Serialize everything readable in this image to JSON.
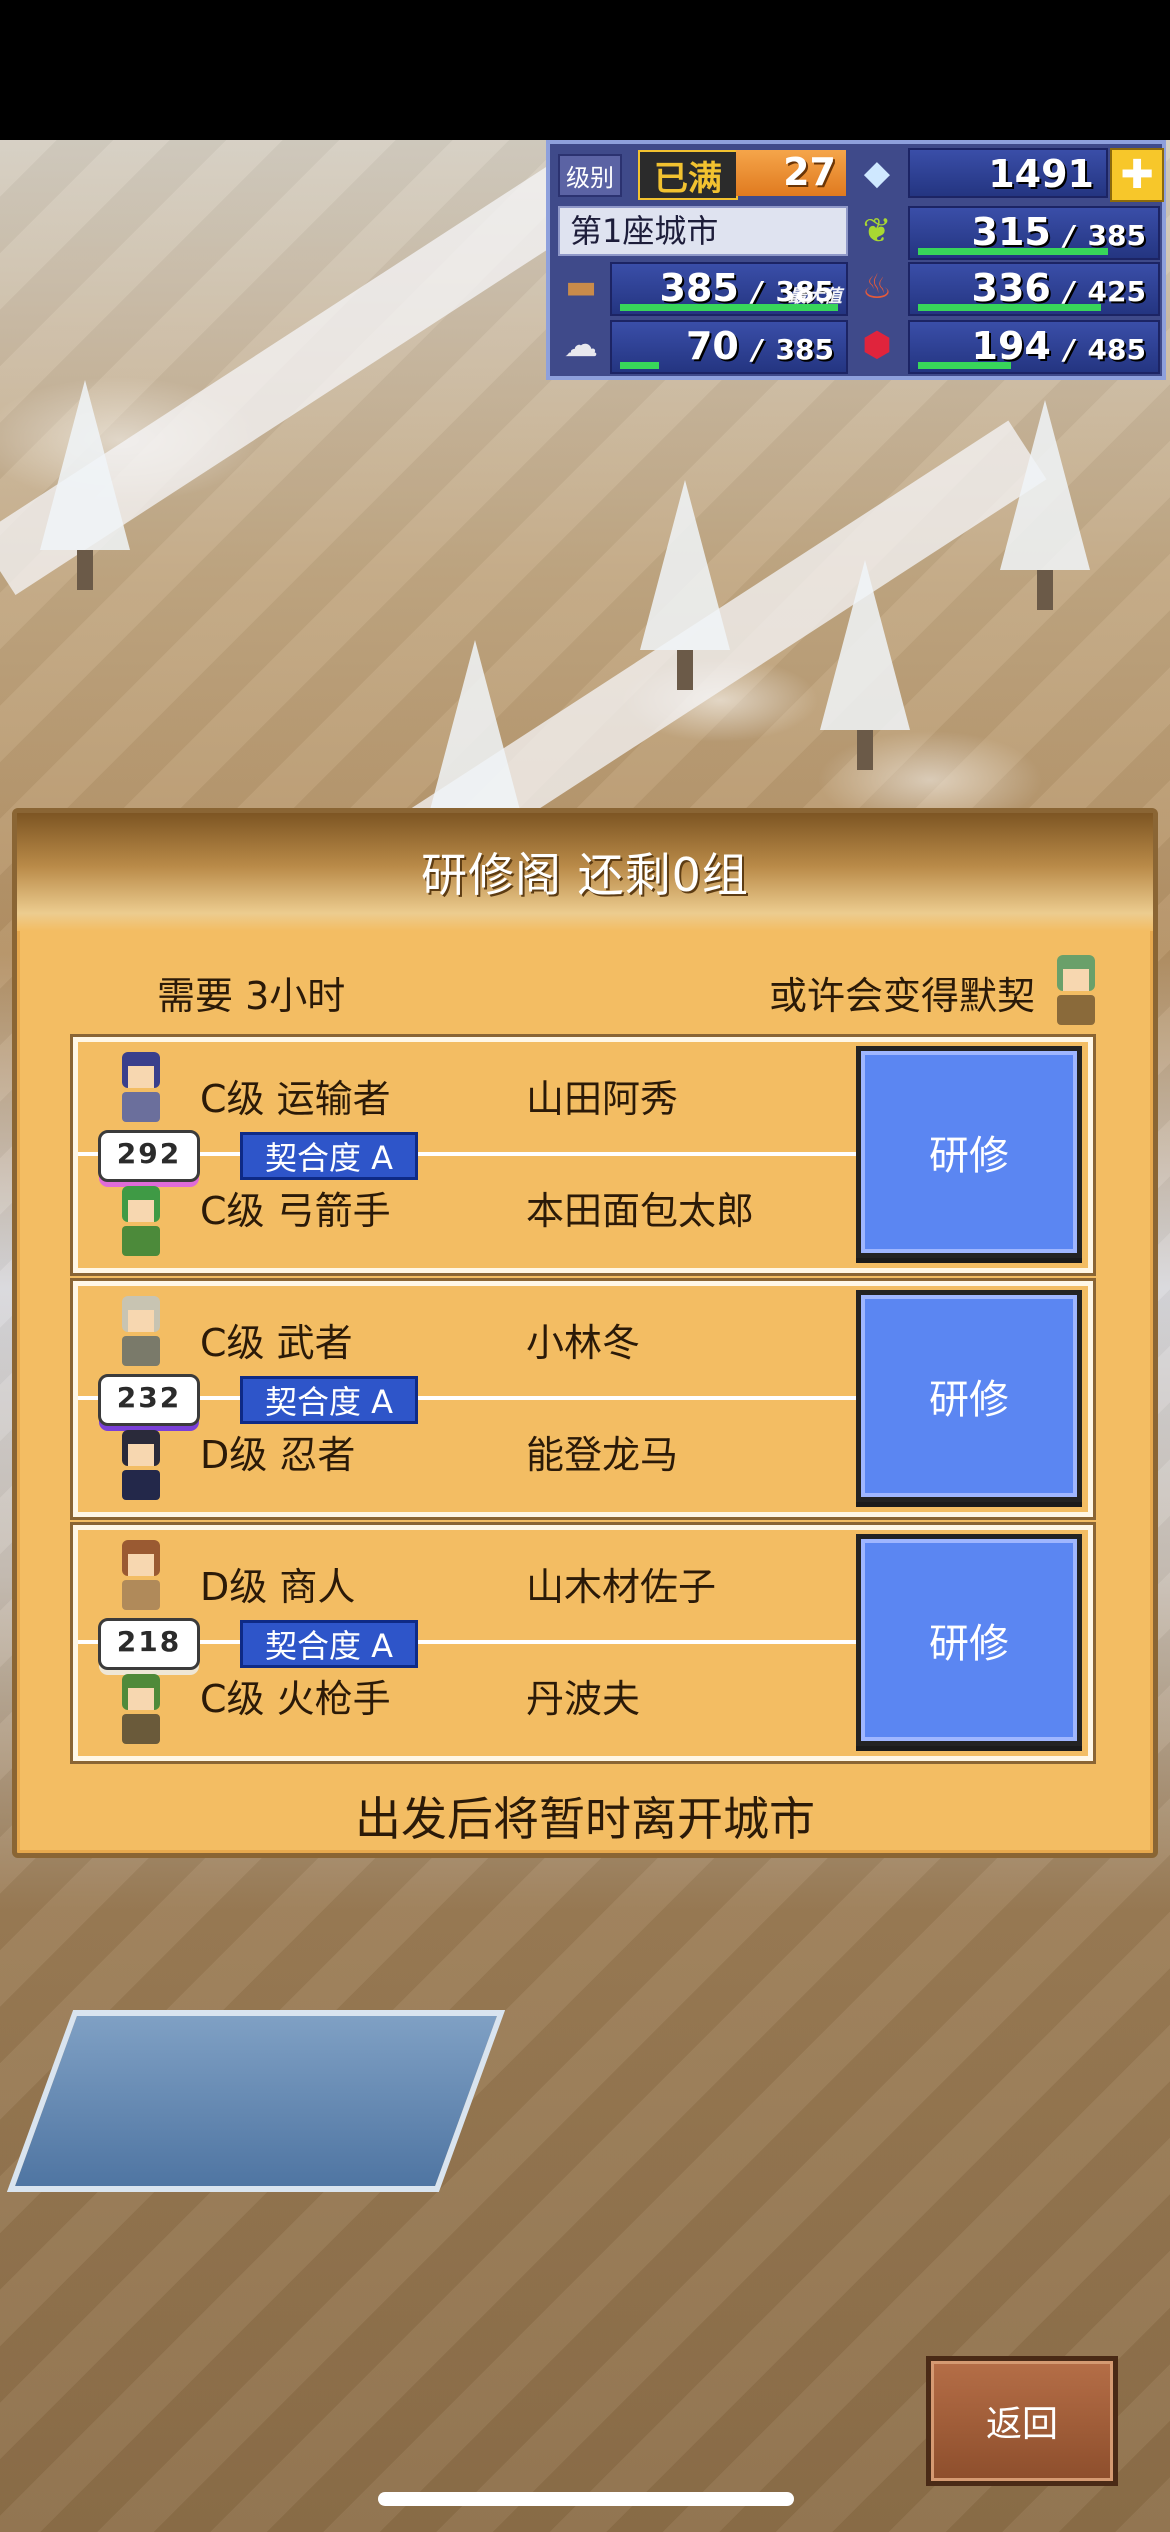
{
  "hud": {
    "level_label": "级别",
    "level_badge": "已满",
    "level_value": "27",
    "gems": "1491",
    "plus_symbol": "✚",
    "city_name": "第1座城市",
    "wood": {
      "value": "385",
      "max": "385",
      "max_note": "最大值",
      "fill": 1.0
    },
    "crop": {
      "value": "315",
      "max": "385",
      "fill": 0.82
    },
    "stone": {
      "value": "70",
      "max": "385",
      "fill": 0.18
    },
    "food": {
      "value": "336",
      "max": "425",
      "fill": 0.79
    },
    "ore": {
      "value": "194",
      "max": "485",
      "fill": 0.4
    },
    "separator": "/"
  },
  "dialog": {
    "title": "研修阁 还剩0组",
    "need_time": "需要 3小时",
    "hint": "或许会变得默契",
    "footer_note": "出发后将暂时离开城市",
    "pairs": [
      {
        "bond_value": "292",
        "member1_class": "C级 运输者",
        "member1_name": "山田阿秀",
        "compat_label": "契合度 A",
        "member2_class": "C级 弓箭手",
        "member2_name": "本田面包太郎",
        "button_label": "研修"
      },
      {
        "bond_value": "232",
        "member1_class": "C级 武者",
        "member1_name": "小林冬",
        "compat_label": "契合度 A",
        "member2_class": "D级 忍者",
        "member2_name": "能登龙马",
        "button_label": "研修"
      },
      {
        "bond_value": "218",
        "member1_class": "D级 商人",
        "member1_name": "山木材佐子",
        "compat_label": "契合度 A",
        "member2_class": "C级 火枪手",
        "member2_name": "丹波夫",
        "button_label": "研修"
      }
    ]
  },
  "back_button": "返回",
  "colors": {
    "panel": "#f3bd63",
    "button_blue": "#5b86f2",
    "compat_blue": "#2e55c9",
    "hud_blue": "#243581",
    "bar_green": "#38d65a"
  }
}
